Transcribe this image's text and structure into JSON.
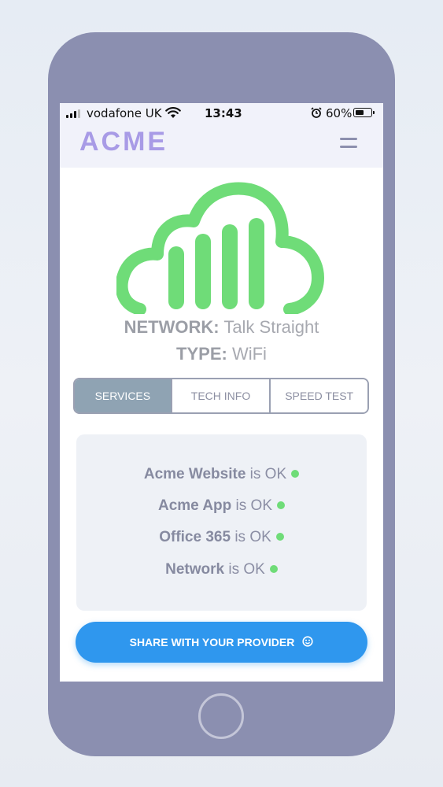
{
  "status_bar": {
    "carrier": "vodafone UK",
    "time": "13:43",
    "battery_percent": "60%",
    "battery_level": 0.6,
    "signal_bars_active": 3,
    "icons": [
      "signal-icon",
      "wifi-icon",
      "alarm-icon",
      "battery-icon"
    ]
  },
  "header": {
    "logo": "ACME",
    "menu_icon": "hamburger-menu-icon"
  },
  "hero": {
    "icon": "cloud-network-bars-icon",
    "network_label": "NETWORK:",
    "network_value": "Talk Straight",
    "type_label": "TYPE:",
    "type_value": "WiFi"
  },
  "tabs": [
    {
      "label": "SERVICES",
      "active": true
    },
    {
      "label": "TECH INFO",
      "active": false
    },
    {
      "label": "SPEED TEST",
      "active": false
    }
  ],
  "services": [
    {
      "name": "Acme Website",
      "status_text": "is OK",
      "status": "ok"
    },
    {
      "name": "Acme App",
      "status_text": "is OK",
      "status": "ok"
    },
    {
      "name": "Office 365",
      "status_text": "is OK",
      "status": "ok"
    },
    {
      "name": "Network",
      "status_text": "is OK",
      "status": "ok"
    }
  ],
  "share_button": {
    "label": "SHARE WITH YOUR PROVIDER",
    "icon": "smiley-icon"
  },
  "colors": {
    "accent": "#a89be6",
    "cloud_green": "#6fdc78",
    "status_ok": "#6fdc78",
    "primary_button": "#2f97ee",
    "active_tab": "#8fa3b3",
    "phone_frame": "#8b8fb0"
  }
}
